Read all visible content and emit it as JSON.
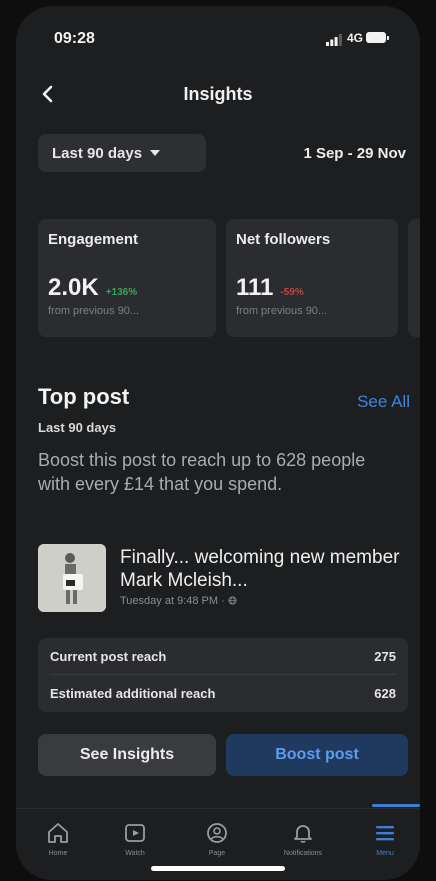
{
  "status_bar": {
    "time": "09:28",
    "network": "4G"
  },
  "header": {
    "title": "Insights"
  },
  "filter": {
    "period_label": "Last 90 days",
    "date_range": "1 Sep - 29 Nov"
  },
  "metrics": [
    {
      "label": "Engagement",
      "value": "2.0K",
      "delta": "+136%",
      "trend": "up",
      "sub": "from previous 90..."
    },
    {
      "label": "Net followers",
      "value": "111",
      "delta": "-59%",
      "trend": "down",
      "sub": "from previous 90..."
    }
  ],
  "top_post": {
    "title": "Top post",
    "see_all": "See All",
    "period": "Last 90 days",
    "boost_description": "Boost this post to reach up to 628 people with every £14 that you spend.",
    "post_title": "Finally... welcoming new member Mark Mcleish...",
    "post_meta": "Tuesday at 9:48 PM ·"
  },
  "reach": [
    {
      "label": "Current post reach",
      "value": "275"
    },
    {
      "label": "Estimated additional reach",
      "value": "628"
    }
  ],
  "actions": {
    "see_insights": "See Insights",
    "boost_post": "Boost post"
  },
  "tabs": [
    {
      "label": "Home",
      "icon": "home-icon"
    },
    {
      "label": "Watch",
      "icon": "watch-icon"
    },
    {
      "label": "Page",
      "icon": "page-icon"
    },
    {
      "label": "Notifications",
      "icon": "bell-icon"
    },
    {
      "label": "Menu",
      "icon": "menu-icon",
      "active": true
    }
  ],
  "colors": {
    "background": "#1d1e20",
    "card": "#2b2c2f",
    "accent": "#3d85e0",
    "positive": "#3aa35a",
    "negative": "#c0443c"
  }
}
